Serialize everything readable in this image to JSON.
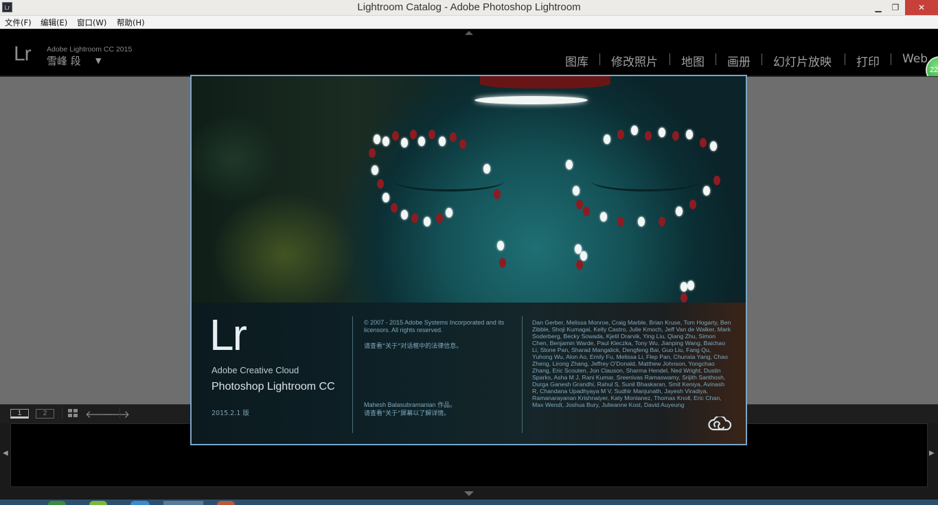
{
  "window": {
    "icon_text": "Lr",
    "title": "Lightroom Catalog - Adobe Photoshop Lightroom",
    "minimize_glyph": "▁",
    "maximize_glyph": "❐",
    "close_glyph": "✕"
  },
  "menu": [
    "文件(F)",
    "编辑(E)",
    "窗口(W)",
    "帮助(H)"
  ],
  "identity": {
    "logo": "Lr",
    "version": "Adobe Lightroom CC 2015",
    "user": "雪峰 段",
    "caret": "▼"
  },
  "modules": [
    "图库",
    "修改照片",
    "地图",
    "画册",
    "幻灯片放映",
    "打印",
    "Web"
  ],
  "badge": "22",
  "filmstrip": {
    "tab1": "1",
    "tab2": "2",
    "prev_glyph": "🡐",
    "next_glyph": "🡒",
    "left_glyph": "◀",
    "right_glyph": "▶"
  },
  "splash": {
    "logo": "Lr",
    "brand": "Adobe Creative Cloud",
    "product": "Photoshop Lightroom CC",
    "version": "2015.2.1 版",
    "copyright": "© 2007 - 2015 Adobe Systems Incorporated and its licensors. All rights reserved.",
    "legal_note": "请查看\"关于\"对话框中的法律信息。",
    "artist": "Mahesh Balasubramanian 作品。",
    "artist_note": "请查看\"关于\"屏幕以了解详情。",
    "credits": "Dan Gerber, Melissa Monroe, Craig Marble, Brian Kruse, Tom Hogarty, Ben Zibble, Shoji Kumagai, Kelly Castro, Julie Kmoch, Jeff Van de Walker, Mark Soderberg, Becky Sowada, Kjetil Drarvik, Ying Liu, Qiang Zhu, Simon Chen, Benjamin Warde, Paul Kleczka, Tony Wu, Jianping Wang, Baichao Li, Stone Pan, Sharad Mangalick, Dengfeng Bai, Guo Liu, Fang Qu, Yuhong Wu, Alon Ao, Emily Fu, Melissa Li, Flep Pan, Chunxia Yang, Chao Zheng, Lirong Zhang, Jeffrey O'Donald, Matthew Johnson, Yongchao Zhang, Eric Scouten, Jon Clauson, Sharma Hendel, Ned Wright, Dustin Sparks, Asha M J, Rani Kumar, Sreenivas Ramaswamy, Srijith Santhosh, Durga Ganesh Grandhi, Rahul S, Sunil Bhaskaran, Smit Keniya, Avinash R, Chandana Upadhyaya M V, Sudhir Manjunath, Jayesh Viradiya, Ramanarayanan Krishnaiyer, Katy Montanez, Thomas Knoll, Eric Chan, Max Wendt, Joshua Bury, Julieanne Kost, David Auyeung"
  },
  "colors": {
    "splash_border": "#7aa6c9",
    "close_button": "#c7403a",
    "badge_green": "#1f9b35"
  }
}
